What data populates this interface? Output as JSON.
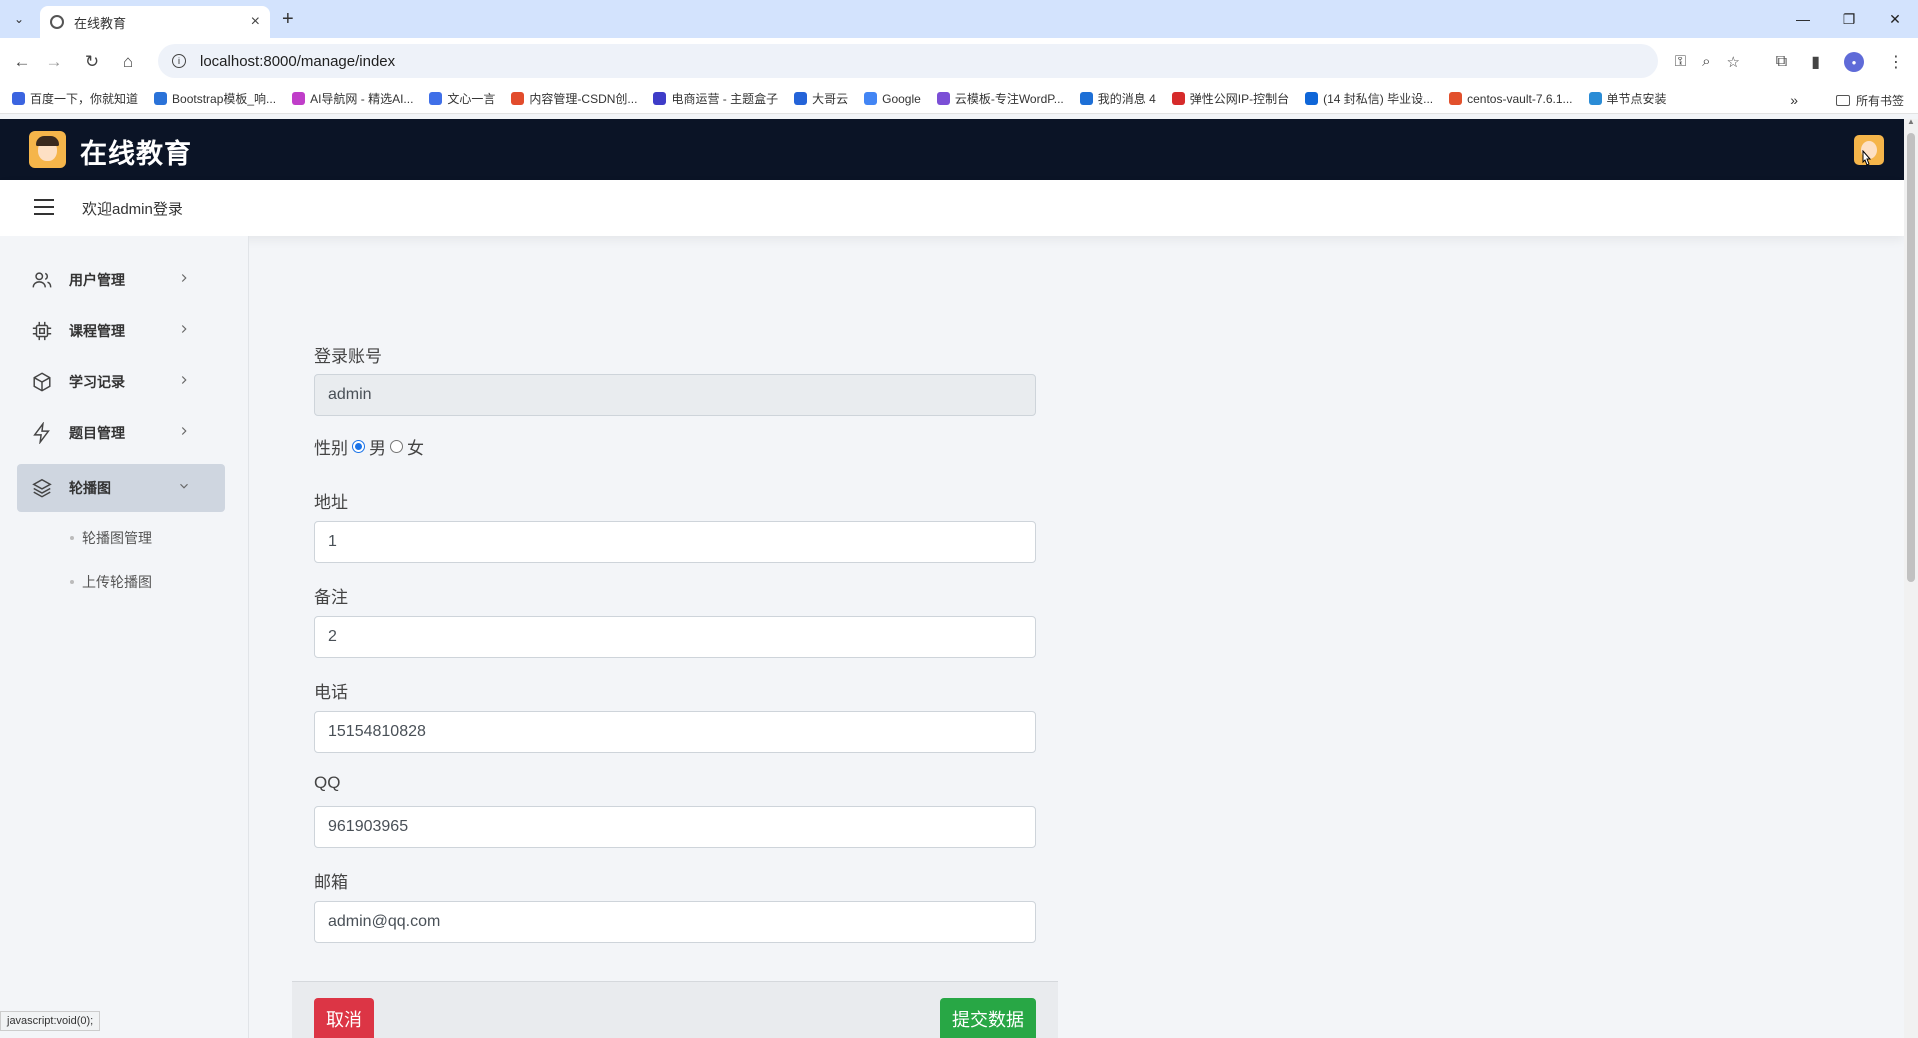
{
  "browser": {
    "tab_title": "在线教育",
    "url": "localhost:8000/manage/index",
    "status_url": "javascript:void(0);",
    "bookmarks": [
      {
        "label": "百度一下，你就知道",
        "color": "#3b64e0"
      },
      {
        "label": "Bootstrap模板_响...",
        "color": "#2a72d8"
      },
      {
        "label": "AI导航网 - 精选AI...",
        "color": "#c03ec9"
      },
      {
        "label": "文心一言",
        "color": "#3f6fe8"
      },
      {
        "label": "内容管理-CSDN创...",
        "color": "#e24c2c"
      },
      {
        "label": "电商运营 - 主题盒子",
        "color": "#3e3cc8"
      },
      {
        "label": "大哥云",
        "color": "#2463d8"
      },
      {
        "label": "Google",
        "color": "#4285f4"
      },
      {
        "label": "云模板-专注WordP...",
        "color": "#7b4fd6"
      },
      {
        "label": "我的消息 4",
        "color": "#1d6fd6"
      },
      {
        "label": "弹性公网IP-控制台",
        "color": "#d62b2b"
      },
      {
        "label": "(14 封私信) 毕业设...",
        "color": "#0f66d8"
      },
      {
        "label": "centos-vault-7.6.1...",
        "color": "#e2502c"
      },
      {
        "label": "单节点安装",
        "color": "#2a8cd6"
      }
    ],
    "bookmarks_folder": "所有书签"
  },
  "app": {
    "title": "在线教育",
    "welcome": "欢迎admin登录"
  },
  "sidebar": {
    "items": [
      {
        "label": "用户管理",
        "icon": "users-icon"
      },
      {
        "label": "课程管理",
        "icon": "chip-icon"
      },
      {
        "label": "学习记录",
        "icon": "cube-icon"
      },
      {
        "label": "题目管理",
        "icon": "bolt-icon"
      },
      {
        "label": "轮播图",
        "icon": "layers-icon",
        "active": true
      }
    ],
    "submenu": [
      {
        "label": "轮播图管理"
      },
      {
        "label": "上传轮播图"
      }
    ]
  },
  "form": {
    "account_label": "登录账号",
    "account_value": "admin",
    "gender_label": "性别",
    "gender_male": "男",
    "gender_female": "女",
    "gender_selected": "男",
    "address_label": "地址",
    "address_value": "1",
    "remark_label": "备注",
    "remark_value": "2",
    "phone_label": "电话",
    "phone_value": "15154810828",
    "qq_label": "QQ",
    "qq_value": "961903965",
    "email_label": "邮箱",
    "email_value": "admin@qq.com",
    "cancel_label": "取消",
    "submit_label": "提交数据"
  },
  "colors": {
    "header_bg": "#0b1426",
    "cancel": "#dc3545",
    "submit": "#28a745"
  }
}
